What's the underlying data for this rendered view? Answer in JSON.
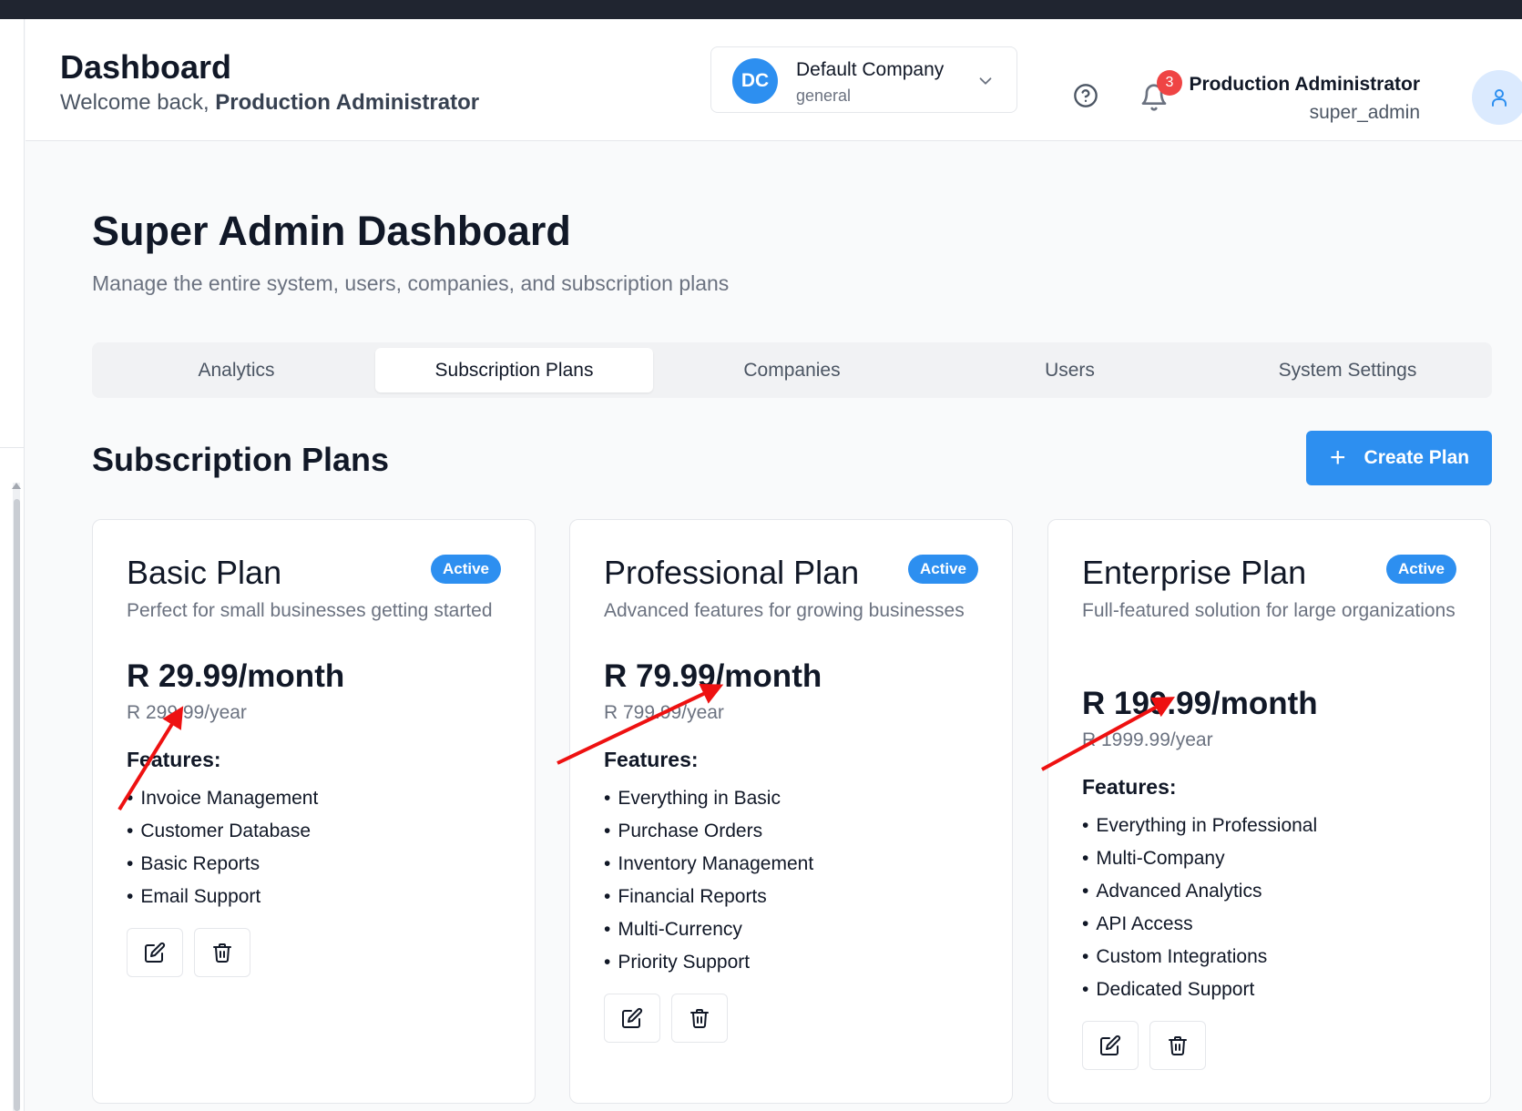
{
  "header": {
    "title": "Dashboard",
    "welcome_prefix": "Welcome back, ",
    "welcome_name": "Production Administrator",
    "company": {
      "initials": "DC",
      "name": "Default Company",
      "type": "general"
    },
    "notifications_count": "3",
    "user": {
      "name": "Production Administrator",
      "role": "super_admin"
    }
  },
  "page": {
    "title": "Super Admin Dashboard",
    "subtitle": "Manage the entire system, users, companies, and subscription plans"
  },
  "tabs": [
    {
      "label": "Analytics",
      "active": false
    },
    {
      "label": "Subscription Plans",
      "active": true
    },
    {
      "label": "Companies",
      "active": false
    },
    {
      "label": "Users",
      "active": false
    },
    {
      "label": "System Settings",
      "active": false
    }
  ],
  "section": {
    "title": "Subscription Plans",
    "create_label": "Create Plan"
  },
  "plans": [
    {
      "name": "Basic Plan",
      "status": "Active",
      "description": "Perfect for small businesses getting started",
      "monthly": "R 29.99/month",
      "yearly": "R 299.99/year",
      "features_title": "Features:",
      "features": [
        "Invoice Management",
        "Customer Database",
        "Basic Reports",
        "Email Support"
      ]
    },
    {
      "name": "Professional Plan",
      "status": "Active",
      "description": "Advanced features for growing businesses",
      "monthly": "R 79.99/month",
      "yearly": "R 799.99/year",
      "features_title": "Features:",
      "features": [
        "Everything in Basic",
        "Purchase Orders",
        "Inventory Management",
        "Financial Reports",
        "Multi-Currency",
        "Priority Support"
      ]
    },
    {
      "name": "Enterprise Plan",
      "status": "Active",
      "description": "Full-featured solution for large organizations",
      "monthly": "R 199.99/month",
      "yearly": "R 1999.99/year",
      "features_title": "Features:",
      "features": [
        "Everything in Professional",
        "Multi-Company",
        "Advanced Analytics",
        "API Access",
        "Custom Integrations",
        "Dedicated Support"
      ]
    }
  ],
  "colors": {
    "accent": "#2d8ff0",
    "badge": "#ef4444",
    "annotation": "#ee1111"
  },
  "icons": [
    "chevron-down-icon",
    "help-circle-icon",
    "bell-icon",
    "user-icon",
    "plus-icon",
    "edit-icon",
    "trash-icon"
  ]
}
